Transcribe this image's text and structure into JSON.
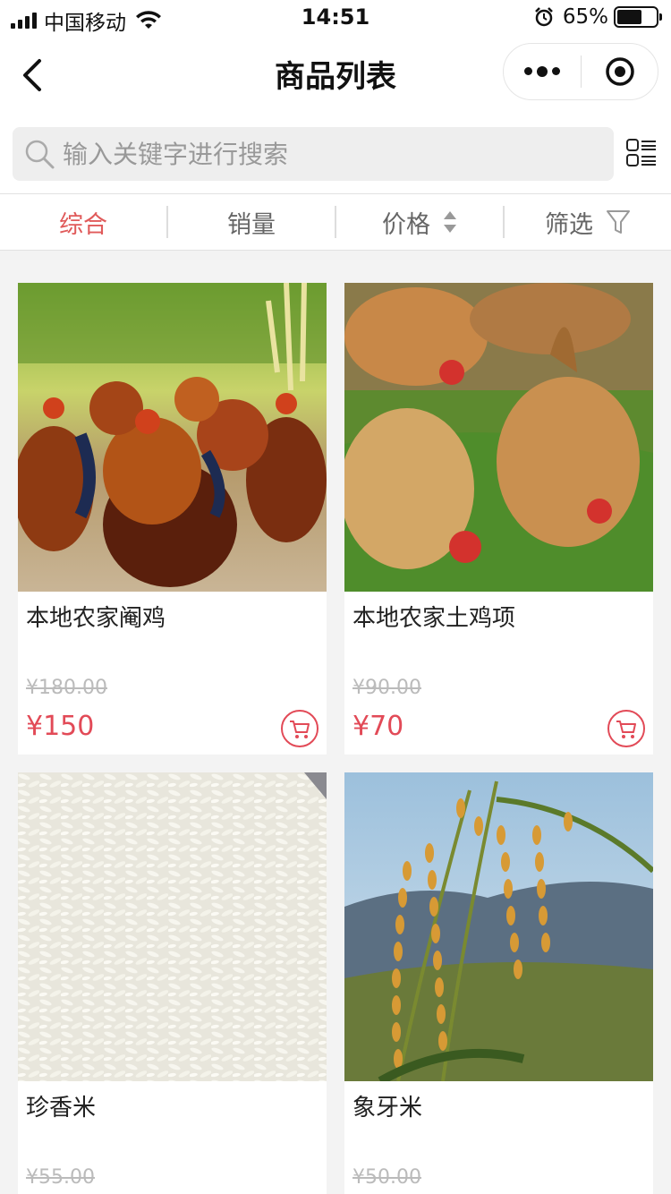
{
  "status_bar": {
    "carrier": "中国移动",
    "time": "14:51",
    "battery_percent": "65%",
    "battery_level": 0.65
  },
  "nav": {
    "title": "商品列表",
    "back_icon": "chevron-left-icon",
    "more_icon": "more-dots-icon",
    "close_icon": "target-circle-icon"
  },
  "search": {
    "placeholder": "输入关键字进行搜索",
    "value": ""
  },
  "sort_tabs": [
    {
      "label": "综合",
      "active": true
    },
    {
      "label": "销量",
      "active": false
    },
    {
      "label": "价格",
      "active": false,
      "icon": "sort-arrows-icon"
    },
    {
      "label": "筛选",
      "active": false,
      "icon": "filter-funnel-icon"
    }
  ],
  "products": [
    {
      "name": "本地农家阉鸡",
      "original_price": "¥180.00",
      "price": "¥150",
      "image": "roosters-photo"
    },
    {
      "name": "本地农家土鸡项",
      "original_price": "¥90.00",
      "price": "¥70",
      "image": "hens-on-grass-photo"
    },
    {
      "name": "珍香米",
      "original_price": "¥55.00",
      "price": "",
      "image": "white-rice-photo"
    },
    {
      "name": "象牙米",
      "original_price": "¥50.00",
      "price": "",
      "image": "rice-plant-photo"
    }
  ],
  "colors": {
    "accent": "#e05a5a",
    "price": "#e24a57",
    "background": "#f3f3f3"
  }
}
